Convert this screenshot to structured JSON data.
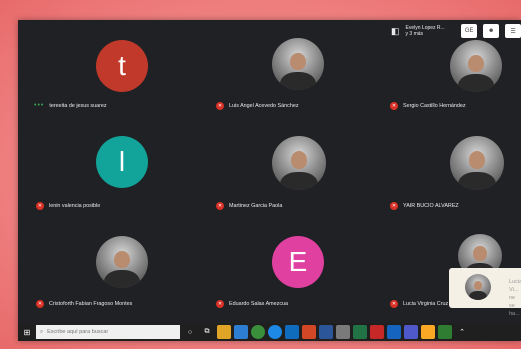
{
  "top_bar": {
    "presenter_line1": "Evelyn Lopez R...",
    "presenter_line2": "y 3 más",
    "button1_label": "GE",
    "button2_label": "☻",
    "button3_label": "☰"
  },
  "participants": [
    {
      "name": "tereeita de jesus suarez",
      "avatar_letter": "t",
      "avatar_color": "#c0392b",
      "type": "letter",
      "status": "speaking"
    },
    {
      "name": "Luis Angel Acevedo Sánchez",
      "avatar_letter": "",
      "avatar_color": "",
      "type": "photo",
      "status": "muted"
    },
    {
      "name": "Sergio Castillo Hernández",
      "avatar_letter": "",
      "avatar_color": "",
      "type": "photo",
      "status": "muted"
    },
    {
      "name": "lenin valencia posible",
      "avatar_letter": "l",
      "avatar_color": "#12a39a",
      "type": "letter",
      "status": "muted"
    },
    {
      "name": "Martinez Garcia Paola",
      "avatar_letter": "",
      "avatar_color": "",
      "type": "photo",
      "status": "muted"
    },
    {
      "name": "YAIR BUCIO ALVAREZ",
      "avatar_letter": "",
      "avatar_color": "",
      "type": "photo",
      "status": "muted"
    },
    {
      "name": "Cristoforth Fabian Fragoso Montes",
      "avatar_letter": "",
      "avatar_color": "",
      "type": "photo",
      "status": "muted"
    },
    {
      "name": "Eduardo Salas Amezcua",
      "avatar_letter": "E",
      "avatar_color": "#e040a0",
      "type": "letter",
      "status": "muted"
    },
    {
      "name": "Lucia Virginia Cruz Ruelas",
      "avatar_letter": "",
      "avatar_color": "",
      "type": "photo",
      "status": "muted"
    }
  ],
  "toast": {
    "line1": "Lucia Vi...",
    "line2": "ne se ha..."
  },
  "taskbar": {
    "search_placeholder": "Escribe aquí para buscar",
    "search_icon": "search-icon"
  }
}
